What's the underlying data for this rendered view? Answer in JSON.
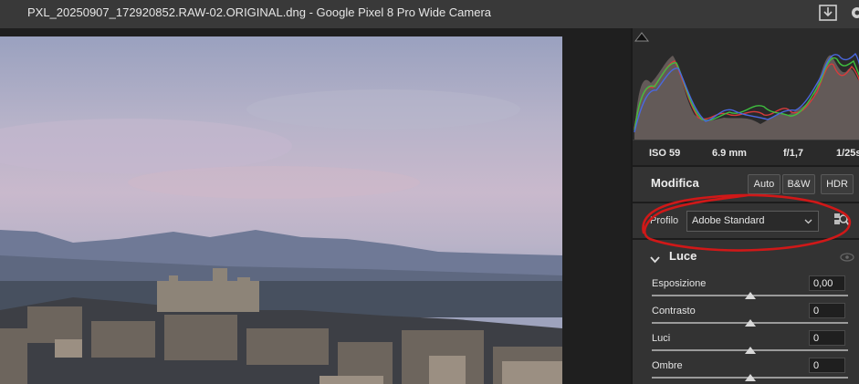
{
  "window": {
    "title": "PXL_20250907_172920852.RAW-02.ORIGINAL.dng  -  Google Pixel 8 Pro Wide Camera"
  },
  "exif": {
    "iso": "ISO 59",
    "focal": "6.9 mm",
    "aperture": "f/1,7",
    "shutter": "1/25s"
  },
  "edit": {
    "title": "Modifica",
    "auto_label": "Auto",
    "bw_label": "B&W",
    "hdr_label": "HDR",
    "profile_label": "Profilo",
    "profile_value": "Adobe Standard"
  },
  "light": {
    "title": "Luce",
    "sliders": [
      {
        "label": "Esposizione",
        "value": "0,00",
        "position": 0.5
      },
      {
        "label": "Contrasto",
        "value": "0",
        "position": 0.5
      },
      {
        "label": "Luci",
        "value": "0",
        "position": 0.5
      },
      {
        "label": "Ombre",
        "value": "0",
        "position": 0.5
      }
    ]
  },
  "colors": {
    "annotation": "#d01818",
    "panel": "#333333"
  }
}
